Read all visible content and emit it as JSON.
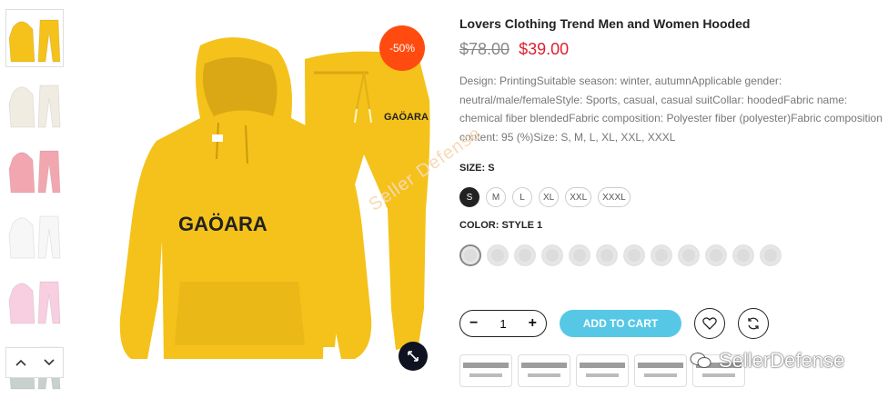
{
  "product": {
    "title": "Lovers Clothing Trend Men and Women Hooded",
    "price_old": "$78.00",
    "price_new": "$39.00",
    "discount_badge": "-50%",
    "description": "Design: PrintingSuitable season: winter, autumnApplicable gender: neutral/male/femaleStyle: Sports, casual, casual suitCollar: hoodedFabric name: chemical fiber blendedFabric composition: Polyester fiber (polyester)Fabric composition content: 95 (%)Size: S, M, L, XL, XXL, XXXL",
    "brand_print": "GAÖARA"
  },
  "size": {
    "label": "SIZE:",
    "selected": "S",
    "options": [
      "S",
      "M",
      "L",
      "XL",
      "XXL",
      "XXXL"
    ]
  },
  "color": {
    "label": "COLOR:",
    "selected": "STYLE 1",
    "swatch_count": 12
  },
  "cart": {
    "quantity": "1",
    "minus": "−",
    "plus": "+",
    "add_label": "ADD TO CART"
  },
  "thumbnails": [
    {
      "name": "yellow",
      "color": "#f4c21a"
    },
    {
      "name": "cream",
      "color": "#f1ece2"
    },
    {
      "name": "pink",
      "color": "#f2a7b0"
    },
    {
      "name": "white",
      "color": "#f7f7f7"
    },
    {
      "name": "light-pink",
      "color": "#f7cfe0"
    },
    {
      "name": "grey",
      "color": "#c9d0d0"
    }
  ],
  "colors": {
    "accent_cart": "#56c8e6",
    "sale_badge": "#ff4b0f",
    "price_new": "#e01e2f",
    "hoodie": "#f4c21a"
  },
  "watermarks": {
    "diagonal": "Seller Defense",
    "corner": "SellerDefense"
  },
  "icons": {
    "thumb_up": "chevron-up-icon",
    "thumb_down": "chevron-down-icon",
    "zoom": "expand-icon",
    "wishlist": "heart-icon",
    "compare": "refresh-icon"
  }
}
